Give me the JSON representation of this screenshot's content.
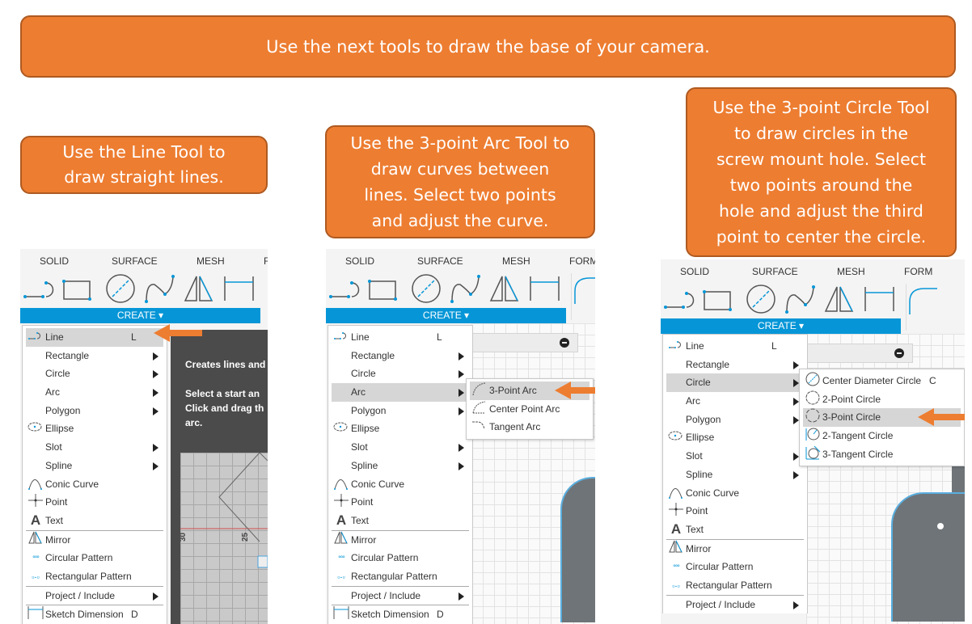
{
  "banner": "Use the next tools to draw the base of your camera.",
  "callouts": [
    [
      "Use the Line Tool to",
      "draw straight lines."
    ],
    [
      "Use the 3-point Arc Tool to",
      "draw curves between",
      "lines. Select two points",
      "and adjust the curve."
    ],
    [
      "Use the 3-point Circle Tool",
      "to draw circles in the",
      "screw mount hole. Select",
      "two points around the",
      "hole and adjust the  third",
      "point to center the circle."
    ]
  ],
  "colors": {
    "callout": "#ED7D31",
    "callout_border": "#AE5A21",
    "create_bar": "#0696D7",
    "icon_blue": "#0696D7",
    "arrow": "#ED7D31"
  },
  "toolbar_icons": [
    "line-icon",
    "rectangle-icon",
    "circle-icon",
    "spline-icon",
    "mirror-icon",
    "dimension-icon"
  ],
  "create_menu": [
    {
      "label": "Line",
      "icon": "line-icon",
      "shortcut": "L"
    },
    {
      "label": "Rectangle",
      "submenu": true
    },
    {
      "label": "Circle",
      "submenu": true
    },
    {
      "label": "Arc",
      "submenu": true
    },
    {
      "label": "Polygon",
      "submenu": true
    },
    {
      "label": "Ellipse",
      "icon": "ellipse-icon"
    },
    {
      "label": "Slot",
      "submenu": true
    },
    {
      "label": "Spline",
      "submenu": true
    },
    {
      "label": "Conic Curve",
      "icon": "conic-curve-icon"
    },
    {
      "label": "Point",
      "icon": "point-icon"
    },
    {
      "label": "Text",
      "icon": "text-icon"
    },
    {
      "divider": true
    },
    {
      "label": "Mirror",
      "icon": "mirror-icon"
    },
    {
      "label": "Circular Pattern",
      "icon": "circular-pattern-icon"
    },
    {
      "label": "Rectangular Pattern",
      "icon": "rectangular-pattern-icon"
    },
    {
      "divider": true
    },
    {
      "label": "Project / Include",
      "submenu": true
    }
  ],
  "sketch_dimension": {
    "label": "Sketch Dimension",
    "icon": "dimension-icon",
    "shortcut": "D"
  },
  "panels": [
    {
      "tabs": [
        "SOLID",
        "SURFACE",
        "MESH",
        "F"
      ],
      "create_label": "CREATE ▾",
      "highlighted": "Line",
      "tooltip": {
        "title": "Creates lines and",
        "lines": [
          "Select a start an",
          "Click and drag th",
          "arc."
        ]
      },
      "canvas_labels": [
        "30",
        "25"
      ]
    },
    {
      "tabs": [
        "SOLID",
        "SURFACE",
        "MESH",
        "FORM"
      ],
      "create_label": "CREATE ▾",
      "highlighted": "Arc",
      "submenu": {
        "highlighted": "3-Point Arc",
        "items": [
          {
            "label": "3-Point Arc",
            "icon": "three-point-arc-icon"
          },
          {
            "label": "Center Point Arc",
            "icon": "center-point-arc-icon"
          },
          {
            "label": "Tangent Arc",
            "icon": "tangent-arc-icon"
          }
        ]
      }
    },
    {
      "tabs": [
        "SOLID",
        "SURFACE",
        "MESH",
        "FORM"
      ],
      "create_label": "CREATE ▾",
      "highlighted": "Circle",
      "submenu": {
        "highlighted": "3-Point Circle",
        "items": [
          {
            "label": "Center Diameter Circle",
            "icon": "center-diameter-circle-icon",
            "shortcut": "C"
          },
          {
            "label": "2-Point Circle",
            "icon": "two-point-circle-icon"
          },
          {
            "label": "3-Point Circle",
            "icon": "three-point-circle-icon"
          },
          {
            "label": "2-Tangent Circle",
            "icon": "two-tangent-circle-icon"
          },
          {
            "label": "3-Tangent Circle",
            "icon": "three-tangent-circle-icon"
          }
        ]
      }
    }
  ]
}
